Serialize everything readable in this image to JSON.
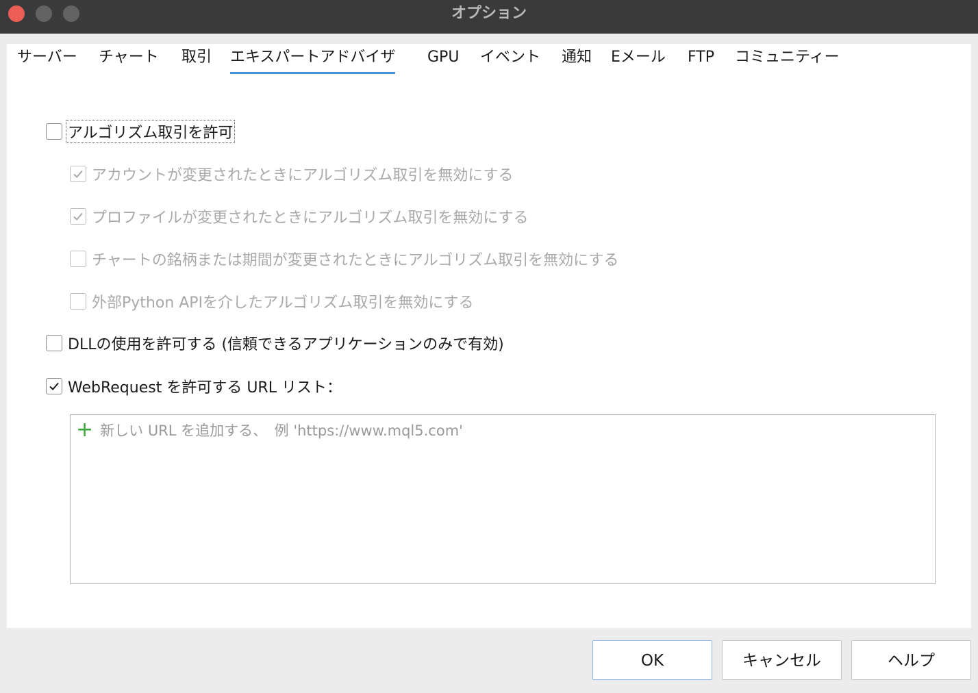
{
  "window": {
    "title": "オプション"
  },
  "tabs": [
    {
      "label": "サーバー"
    },
    {
      "label": "チャート"
    },
    {
      "label": "取引"
    },
    {
      "label": "エキスパートアドバイザ",
      "active": true
    },
    {
      "label": "GPU"
    },
    {
      "label": "イベント"
    },
    {
      "label": "通知"
    },
    {
      "label": "Eメール"
    },
    {
      "label": "FTP"
    },
    {
      "label": "コミュニティー"
    }
  ],
  "options": {
    "allow_algo": {
      "label": "アルゴリズム取引を許可",
      "checked": false
    },
    "disable_on_account": {
      "label": "アカウントが変更されたときにアルゴリズム取引を無効にする",
      "checked": true,
      "disabled": true
    },
    "disable_on_profile": {
      "label": "プロファイルが変更されたときにアルゴリズム取引を無効にする",
      "checked": true,
      "disabled": true
    },
    "disable_on_symbol": {
      "label": "チャートの銘柄または期間が変更されたときにアルゴリズム取引を無効にする",
      "checked": false,
      "disabled": true
    },
    "disable_python": {
      "label": "外部Python APIを介したアルゴリズム取引を無効にする",
      "checked": false,
      "disabled": true
    },
    "allow_dll": {
      "label": "DLLの使用を許可する (信頼できるアプリケーションのみで有効)",
      "checked": false
    },
    "allow_webrequest": {
      "label": "WebRequest を許可する URL リスト：",
      "checked": true
    }
  },
  "url_list": {
    "add_placeholder": "新しい URL を追加する、　例 'https://www.mql5.com'"
  },
  "buttons": {
    "ok": "OK",
    "cancel": "キャンセル",
    "help": "ヘルプ"
  },
  "colors": {
    "tab_underline": "#4a90d9",
    "add_icon": "#3aa63a",
    "close_button": "#ec5f57"
  }
}
